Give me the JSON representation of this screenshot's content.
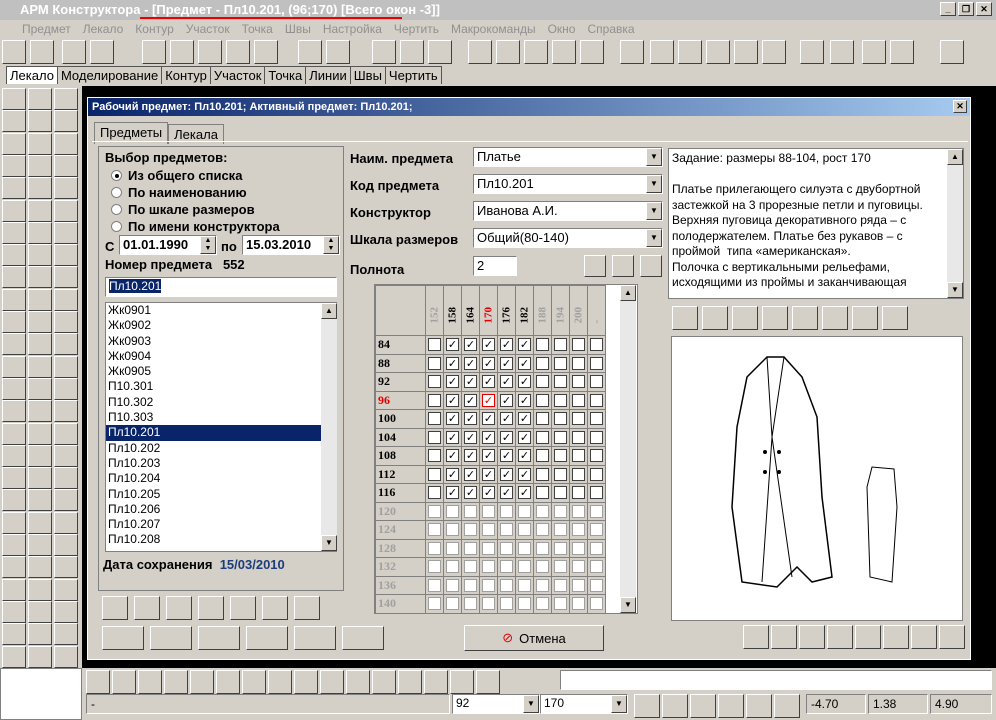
{
  "window": {
    "title": "АРМ Конструктора - [Предмет - Пл10.201, (96;170) [Всего окон -3]]"
  },
  "menu": [
    "Предмет",
    "Лекало",
    "Контур",
    "Участок",
    "Точка",
    "Швы",
    "Настройка",
    "Чертить",
    "Макрокоманды",
    "Окно",
    "Справка"
  ],
  "tabs": [
    "Лекало",
    "Моделирование",
    "Контур",
    "Участок",
    "Точка",
    "Линии",
    "Швы",
    "Чертить"
  ],
  "dialog": {
    "title": "Рабочий предмет: Пл10.201;  Активный предмет: Пл10.201;",
    "tabs": [
      "Предметы",
      "Лекала"
    ],
    "selection_label": "Выбор предметов:",
    "radios": [
      "Из общего списка",
      "По наименованию",
      "По шкале размеров",
      "По имени конструктора"
    ],
    "selected_radio": 0,
    "date_from_label": "С",
    "date_from": "01.01.1990",
    "date_to_label": "по",
    "date_to": "15.03.2010",
    "number_label": "Номер предмета",
    "number_value": "552",
    "search_value": "Пл10.201",
    "list": [
      "Жк0901",
      "Жк0902",
      "Жк0903",
      "Жк0904",
      "Жк0905",
      "П10.301",
      "П10.302",
      "П10.303",
      "Пл10.201",
      "Пл10.202",
      "Пл10.203",
      "Пл10.204",
      "Пл10.205",
      "Пл10.206",
      "Пл10.207",
      "Пл10.208"
    ],
    "selected_item": "Пл10.201",
    "save_date_label": "Дата сохранения",
    "save_date": "15/03/2010",
    "name_label": "Наим. предмета",
    "name_value": "Платье",
    "code_label": "Код предмета",
    "code_value": "Пл10.201",
    "designer_label": "Конструктор",
    "designer_value": "Иванова А.И.",
    "scale_label": "Шкала размеров",
    "scale_value": "Общий(80-140)",
    "fullness_label": "Полнота",
    "fullness_value": "2",
    "cancel_label": "Отмена",
    "description": "Задание: размеры 88-104, рост 170\n\nПлатье прилегающего силуэта с двубортной застежкой на 3 прорезные петли и пуговицы. Верхняя пуговица декоративного ряда – с полодержателем. Платье без рукавов – с проймой  типа «американская».\nПолочка с вертикальными рельефами, исходящими из проймы и заканчивающая"
  },
  "grid": {
    "heights": [
      "152",
      "158",
      "164",
      "170",
      "176",
      "182",
      "188",
      "194",
      "200",
      "-"
    ],
    "active_heights": [
      "158",
      "164",
      "170",
      "176",
      "182"
    ],
    "current_height": "170",
    "sizes": [
      "84",
      "88",
      "92",
      "96",
      "100",
      "104",
      "108",
      "112",
      "116",
      "120",
      "124",
      "128",
      "132",
      "136",
      "140"
    ],
    "active_sizes": [
      "84",
      "88",
      "92",
      "96",
      "100",
      "104",
      "108",
      "112",
      "116"
    ],
    "current_size": "96",
    "accent": "#e00000"
  },
  "statusbar": {
    "left": "-",
    "size": "92",
    "height": "170",
    "x": "-4.70",
    "y": "1.38",
    "z": "4.90"
  }
}
